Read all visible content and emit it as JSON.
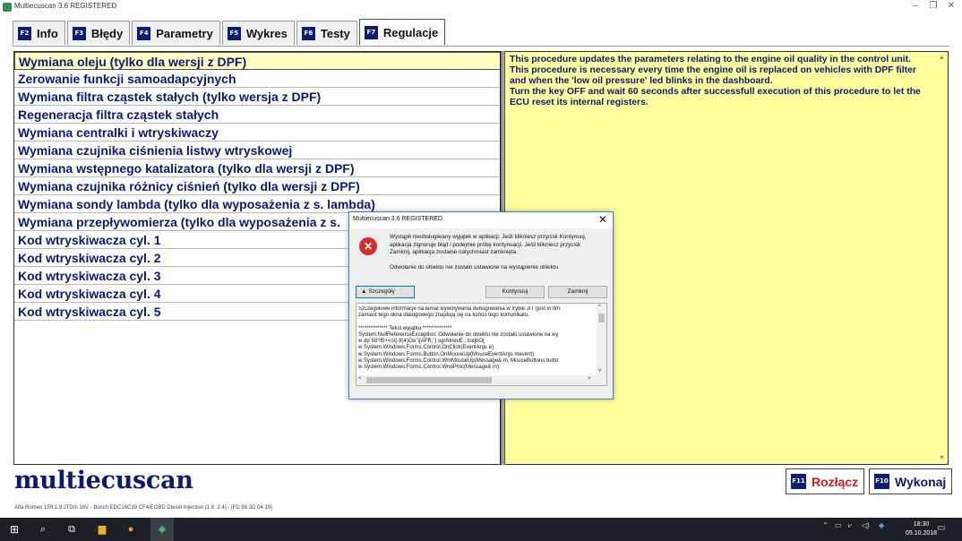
{
  "window": {
    "title": "Multiecuscan 3.6 REGISTERED",
    "controls": {
      "minimize": "–",
      "restore": "❐",
      "close": "✕"
    }
  },
  "tabs": [
    {
      "key": "F2",
      "label": "Info"
    },
    {
      "key": "F3",
      "label": "Błędy"
    },
    {
      "key": "F4",
      "label": "Parametry"
    },
    {
      "key": "F5",
      "label": "Wykres"
    },
    {
      "key": "F6",
      "label": "Testy"
    },
    {
      "key": "F7",
      "label": "Regulacje",
      "active": true
    }
  ],
  "procedures": [
    "Wymiana oleju (tylko dla wersji z DPF)",
    "Zerowanie funkcji samoadapcyjnych",
    "Wymiana filtra cząstek stałych (tylko wersja z DPF)",
    "Regeneracja filtra cząstek stałych",
    "Wymiana centralki i wtryskiwaczy",
    "Wymiana czujnika ciśnienia listwy wtryskowej",
    "Wymiana wstępnego katalizatora (tylko dla wersji z DPF)",
    "Wymiana czujnika różnicy ciśnień (tylko dla wersji z DPF)",
    "Wymiana sondy lambda (tylko dla wyposażenia z s. lambda)",
    "Wymiana przepływomierza (tylko dla wyposażenia z s.",
    "Kod wtryskiwacza cyl. 1",
    "Kod wtryskiwacza cyl. 2",
    "Kod wtryskiwacza cyl. 3",
    "Kod wtryskiwacza cyl. 4",
    "Kod wtryskiwacza cyl. 5"
  ],
  "description": {
    "line1": "This procedure updates the parameters relating to the engine oil quality in the control unit.",
    "line2": "This procedure is necessary every time the engine oil is replaced on vehicles with DPF filter and when the 'low oil pressure' led blinks in the dashboard.",
    "line3": "Turn the key OFF and wait 60 seconds after successfull execution of this procedure to let the ECU reset its internal registers."
  },
  "logo": "multiecuscan",
  "buttons": {
    "disconnect": {
      "key": "F11",
      "label": "Rozłącz",
      "color": "#d02020"
    },
    "execute": {
      "key": "F10",
      "label": "Wykonaj",
      "color": "#0a1a75"
    }
  },
  "status": "Alfa Romeo 159 1.9 JTDm 16V - Bosch EDC16C39 CF4/EOBD Diesel Injection (1.9, 2.4) - [FD 86 3D 04 19]",
  "dialog": {
    "title": "Multiecuscan 3.6 REGISTERED",
    "message": "Wystąpił nieobsługiwany wyjątek w aplikacji. Jeśli klikniesz przycisk Kontynuuj, aplikacja zignoruje błąd i podejmie próbę kontynuacji. Jeśli klikniesz przycisk Zamknij, aplikacja zostanie natychmiast zamknięta.",
    "error": "Odwołanie do obiektu nie zostało ustawione na wystąpienie obiektu.",
    "details_button": "▲  Szczegóły",
    "continue_button": "Kontynuuj",
    "close_button": "Zamknij",
    "details_lines": [
      "Szczegółowe informacje na temat wywoływania debugowania w trybie JIT (just in tim",
      "zamiast tego okna dialogowego znajdują się na końcu tego komunikatu.",
      "",
      "************** Tekst wyjątku **************",
      "System.NullReferenceException: Odwołanie do obiektu nie zostało ustawione na wy",
      "   w dp`50?l5+<o\\[-9(4)Cw`\\[AFR;`) sgrAtnevE , tcejbO(",
      "   w System.Windows.Forms.Control.OnClick(EventArgs e)",
      "   w System.Windows.Forms.Button.OnMouseUp(MouseEventArgs mevent)",
      "   w System.Windows.Forms.Control.WmMouseUp(Message& m, MouseButtons butto",
      "   w System.Windows.Forms.Control.WndProc(Message& m)"
    ]
  },
  "taskbar": {
    "time": "18:30",
    "date": "05.10.2018"
  }
}
